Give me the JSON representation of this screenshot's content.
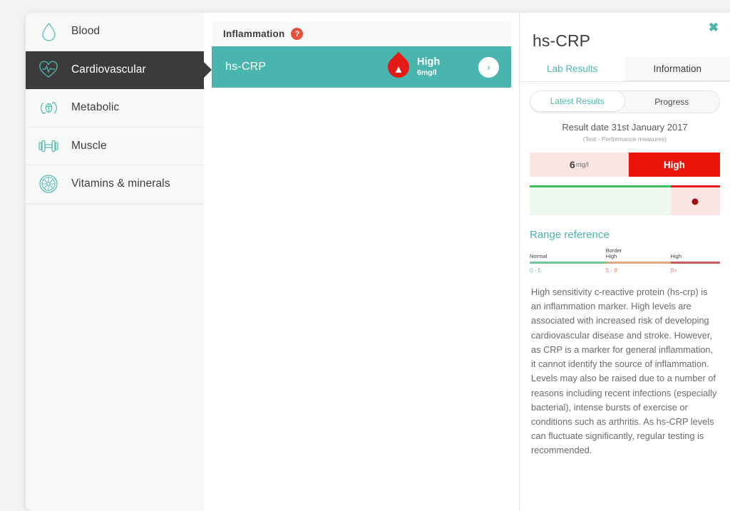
{
  "sidebar": {
    "items": [
      {
        "label": "Blood",
        "icon": "blood-drop-icon",
        "active": false
      },
      {
        "label": "Cardiovascular",
        "icon": "heart-pulse-icon",
        "active": true
      },
      {
        "label": "Metabolic",
        "icon": "metabolic-icon",
        "active": false
      },
      {
        "label": "Muscle",
        "icon": "dumbbell-icon",
        "active": false
      },
      {
        "label": "Vitamins & minerals",
        "icon": "citrus-slice-icon",
        "active": false
      }
    ]
  },
  "middle": {
    "group_title": "Inflammation",
    "help_badge": "?",
    "result": {
      "name": "hs-CRP",
      "status": "High",
      "value_with_unit": "6mg/l",
      "arrow": "›"
    }
  },
  "detail": {
    "title": "hs-CRP",
    "close": "✖",
    "tabs": [
      {
        "label": "Lab Results",
        "active": true
      },
      {
        "label": "Information",
        "active": false
      }
    ],
    "segments": [
      {
        "label": "Latest Results",
        "active": true
      },
      {
        "label": "Progress",
        "active": false
      }
    ],
    "result_date": "Result date 31st January 2017",
    "result_sub": "(Test - Performance measures)",
    "value": {
      "number": "6",
      "unit": "mg/l",
      "status": "High"
    },
    "range_reference": {
      "title": "Range reference",
      "bands": [
        {
          "label": "Normal",
          "range": "0 - 5"
        },
        {
          "label": "Border\nHigh",
          "label_line1": "Border",
          "label_line2": "High",
          "range": "5 - 8"
        },
        {
          "label": "High",
          "range": "8+"
        }
      ]
    },
    "description": "High sensitivity c-reactive protein (hs-crp) is an inflammation marker. High levels are associated with increased risk of developing cardiovascular disease and stroke. However, as CRP is a marker for general inflammation, it cannot identify the source of inflammation. Levels may also be raised due to a number of reasons including recent infections (especially bacterial), intense bursts of exercise or conditions such as arthritis. As hs-CRP levels can fluctuate significantly, regular testing is recommended."
  },
  "colors": {
    "teal": "#49b5ae",
    "dark": "#3b3b3b",
    "red": "#e31b17",
    "status_red": "#ea1508",
    "orange_badge": "#e8503a",
    "green": "#3ac15a"
  }
}
